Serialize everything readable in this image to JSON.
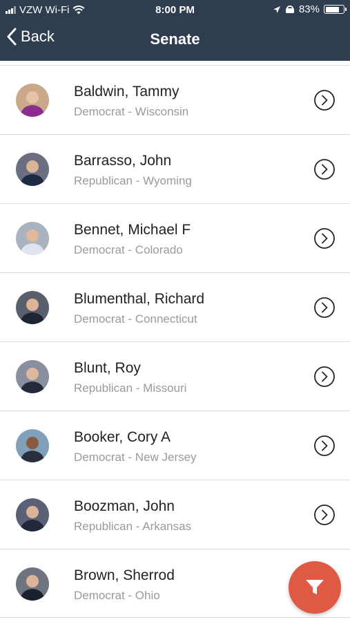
{
  "status_bar": {
    "carrier": "VZW Wi-Fi",
    "time": "8:00 PM",
    "battery": "83%",
    "battery_level": 0.83
  },
  "nav": {
    "back_label": "Back",
    "title": "Senate"
  },
  "senators": [
    {
      "name": "Baldwin, Tammy",
      "detail": "Democrat - Wisconsin"
    },
    {
      "name": "Barrasso, John",
      "detail": "Republican - Wyoming"
    },
    {
      "name": "Bennet, Michael F",
      "detail": "Democrat - Colorado"
    },
    {
      "name": "Blumenthal, Richard",
      "detail": "Democrat - Connecticut"
    },
    {
      "name": "Blunt, Roy",
      "detail": "Republican - Missouri"
    },
    {
      "name": "Booker, Cory A",
      "detail": "Democrat - New Jersey"
    },
    {
      "name": "Boozman, John",
      "detail": "Republican - Arkansas"
    },
    {
      "name": "Brown, Sherrod",
      "detail": "Democrat - Ohio"
    }
  ],
  "icons": {
    "back": "chevron-left-icon",
    "row_action": "chevron-right-circle-icon",
    "fab": "filter-icon"
  },
  "colors": {
    "header": "#2e3d4f",
    "fab": "#de5a45",
    "subtitle": "#9a9a9a"
  }
}
